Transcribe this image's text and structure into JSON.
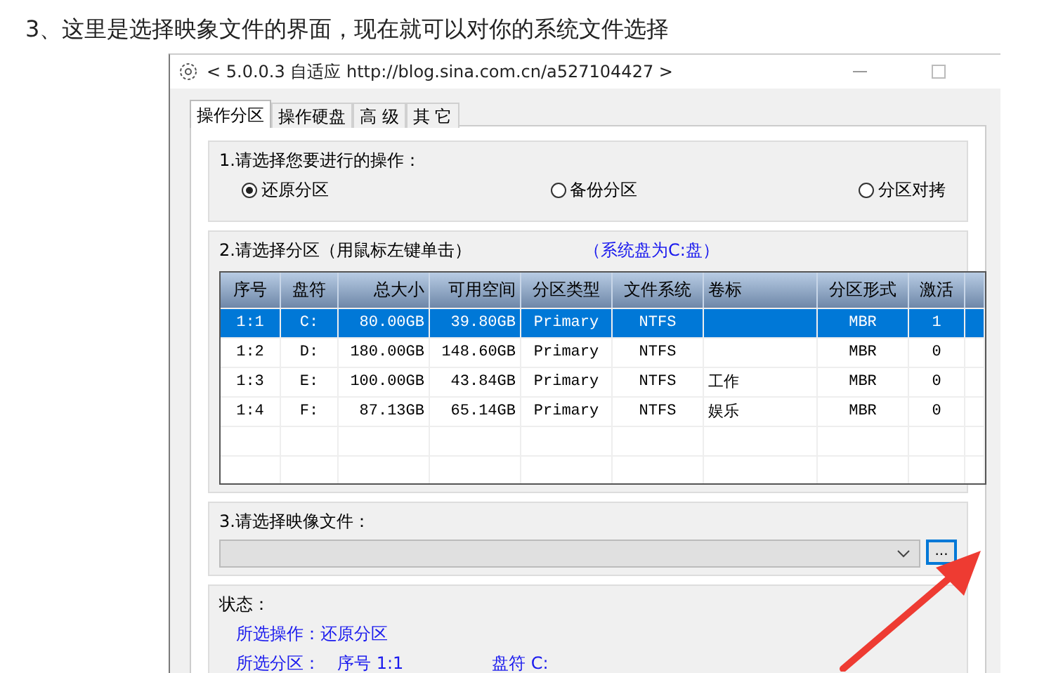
{
  "heading": "3、这里是选择映象文件的界面，现在就可以对你的系统文件选择",
  "window": {
    "title": "< 5.0.0.3 自适应 http://blog.sina.com.cn/a527104427 >"
  },
  "tabs": [
    {
      "label": "操作分区",
      "selected": true
    },
    {
      "label": "操作硬盘",
      "selected": false
    },
    {
      "label": "高 级",
      "selected": false
    },
    {
      "label": "其 它",
      "selected": false
    }
  ],
  "operation": {
    "label": "1.请选择您要进行的操作：",
    "options": [
      {
        "label": "还原分区",
        "selected": true
      },
      {
        "label": "备份分区",
        "selected": false
      },
      {
        "label": "分区对拷",
        "selected": false
      }
    ]
  },
  "partitions": {
    "label": "2.请选择分区（用鼠标左键单击）",
    "note": "（系统盘为C:盘）",
    "columns": [
      "序号",
      "盘符",
      "总大小",
      "可用空间",
      "分区类型",
      "文件系统",
      "卷标",
      "分区形式",
      "激活"
    ],
    "rows": [
      {
        "cells": [
          "1:1",
          "C:",
          "80.00GB",
          "39.80GB",
          "Primary",
          "NTFS",
          "",
          "MBR",
          "1"
        ],
        "selected": true
      },
      {
        "cells": [
          "1:2",
          "D:",
          "180.00GB",
          "148.60GB",
          "Primary",
          "NTFS",
          "",
          "MBR",
          "0"
        ],
        "selected": false
      },
      {
        "cells": [
          "1:3",
          "E:",
          "100.00GB",
          "43.84GB",
          "Primary",
          "NTFS",
          "工作",
          "MBR",
          "0"
        ],
        "selected": false
      },
      {
        "cells": [
          "1:4",
          "F:",
          "87.13GB",
          "65.14GB",
          "Primary",
          "NTFS",
          "娱乐",
          "MBR",
          "0"
        ],
        "selected": false
      }
    ]
  },
  "image_file": {
    "label": "3.请选择映像文件：",
    "browse": "..."
  },
  "status": {
    "label": "状态：",
    "lines": [
      [
        "所选操作：还原分区"
      ],
      [
        "所选分区：",
        "序号 1:1",
        "盘符 C:"
      ]
    ]
  }
}
